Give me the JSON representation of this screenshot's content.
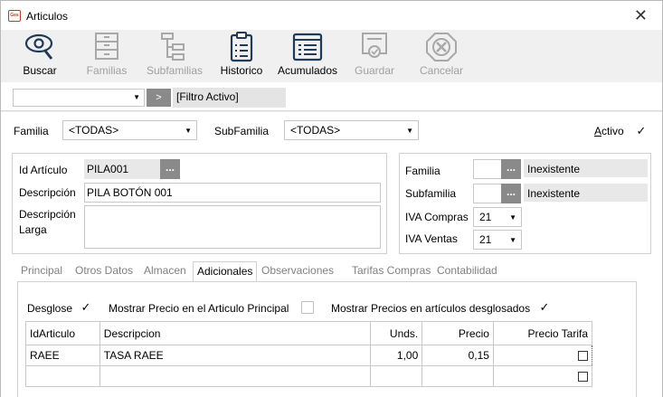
{
  "window": {
    "title": "Articulos",
    "app_icon": "app-logo-icon",
    "close_glyph": "✕"
  },
  "toolbar": {
    "buttons": [
      {
        "label": "Buscar",
        "icon": "search-eye-icon",
        "enabled": true
      },
      {
        "label": "Familias",
        "icon": "drawers-icon",
        "enabled": false
      },
      {
        "label": "Subfamilias",
        "icon": "hierarchy-icon",
        "enabled": false
      },
      {
        "label": "Historico",
        "icon": "clipboard-icon",
        "enabled": true
      },
      {
        "label": "Acumulados",
        "icon": "list-icon",
        "enabled": true
      },
      {
        "label": "Guardar",
        "icon": "certificate-icon",
        "enabled": false
      },
      {
        "label": "Cancelar",
        "icon": "cancel-icon",
        "enabled": false
      }
    ]
  },
  "filterbar": {
    "combo_value": "",
    "go_label": ">",
    "filter_text": "[Filtro Activo]"
  },
  "filters": {
    "familia_label": "Familia",
    "familia_value": "<TODAS>",
    "subfamilia_label": "SubFamilia",
    "subfamilia_value": "<TODAS>",
    "activo_label": "Activo",
    "activo_checked": "✓"
  },
  "article": {
    "id_label": "Id Artículo",
    "id_value": "PILA001",
    "desc_label": "Descripción",
    "desc_value": "PILA BOTÓN 001",
    "long_desc_label_1": "Descripción",
    "long_desc_label_2": "Larga",
    "long_desc_value": "",
    "dots": "..."
  },
  "classification": {
    "familia_label": "Familia",
    "familia_value": "",
    "familia_name": "Inexistente",
    "subfamilia_label": "Subfamilia",
    "subfamilia_value": "",
    "subfamilia_name": "Inexistente",
    "iva_compras_label": "IVA Compras",
    "iva_compras_value": "21",
    "iva_ventas_label": "IVA Ventas",
    "iva_ventas_value": "21",
    "dots": "..."
  },
  "tabs": [
    {
      "label": "Principal",
      "active": false
    },
    {
      "label": "Otros Datos",
      "active": false
    },
    {
      "label": "Almacen",
      "active": false
    },
    {
      "label": "Adicionales",
      "active": true
    },
    {
      "label": "Observaciones",
      "active": false
    },
    {
      "label": "Tarifas Compras",
      "active": false
    },
    {
      "label": "Contabilidad",
      "active": false
    }
  ],
  "adicionales": {
    "desglose_label": "Desglose",
    "desglose_checked": "✓",
    "mostrar_precio_label": "Mostrar Precio en el Articulo Principal",
    "mostrar_precios_label": "Mostrar Precios en artículos desglosados",
    "mostrar_precios_checked": "✓"
  },
  "grid": {
    "columns": [
      "IdArticulo",
      "Descripcion",
      "Unds.",
      "Precio",
      "Precio Tarifa"
    ],
    "rows": [
      {
        "id": "RAEE",
        "desc": "TASA RAEE",
        "units": "1,00",
        "precio": "0,15"
      },
      {
        "id": "",
        "desc": "",
        "units": "",
        "precio": ""
      }
    ]
  }
}
